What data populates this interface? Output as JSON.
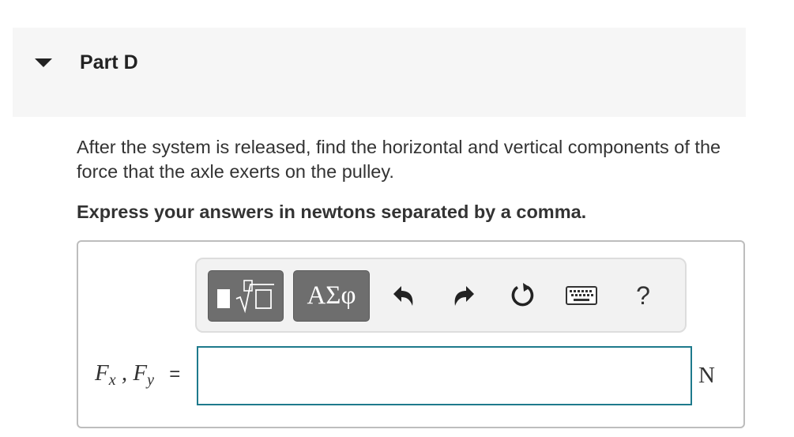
{
  "part": {
    "title": "Part D",
    "expanded": true
  },
  "question": {
    "text": "After the system is released, find the horizontal and vertical components of the force that the axle exerts on the pulley.",
    "instruction": "Express your answers in newtons separated by a comma."
  },
  "toolbar": {
    "symbols_label": "ΑΣφ",
    "help_label": "?",
    "icons": [
      "templates-icon",
      "undo-icon",
      "redo-icon",
      "reset-icon",
      "keyboard-icon",
      "help-icon"
    ]
  },
  "answer": {
    "variable_1": "F",
    "sub_1": "x",
    "separator": ",",
    "variable_2": "F",
    "sub_2": "y",
    "equals": "=",
    "value": "",
    "unit": "N"
  },
  "colors": {
    "input_border": "#1e7a8c",
    "toolbar_button": "#6e6e6e",
    "header_bg": "#f6f6f6"
  }
}
